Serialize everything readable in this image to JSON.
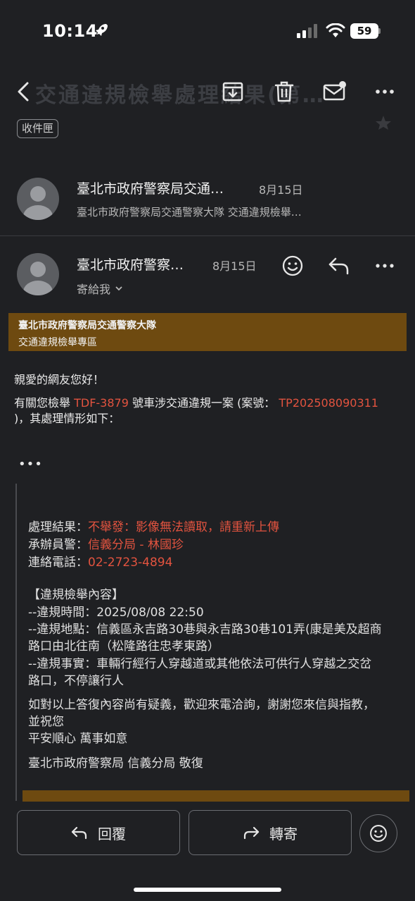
{
  "status": {
    "time": "10:14",
    "battery": "59"
  },
  "toolbar": {
    "ghost_title": "交通違規檢舉處理結果(第…",
    "inbox_label": "收件匣"
  },
  "thread": {
    "first": {
      "sender": "臺北市政府警察局交通…",
      "date": "8月15日",
      "preview": "臺北市政府警察局交通警察大隊 交通違規檢舉…"
    },
    "second": {
      "sender": "臺北市政府警察…",
      "date": "8月15日",
      "to_me": "寄給我"
    }
  },
  "banner": {
    "line1": "臺北市政府警察局交通警察大隊",
    "line2": "交通違規檢舉專區"
  },
  "message": {
    "greeting": "親愛的網友您好！",
    "line_a": "有關您檢舉 ",
    "plate": "TDF-3879",
    "line_b": " 號車涉交通違規一案 (案號： ",
    "case_no": "TP202508090311",
    "line_c": ")，其處理情形如下：",
    "ellipsis": "•••"
  },
  "quoted": {
    "result_label": "處理結果：",
    "result_value": "不舉發：影像無法讀取，請重新上傳",
    "officer_label": "承辦員警：",
    "officer_value": "信義分局 - 林國珍",
    "phone_label": "連絡電話：",
    "phone_value": "02-2723-4894",
    "section_title": "【違規檢舉內容】",
    "time_line": "--違規時間：2025/08/08 22:50",
    "place_line1": "--違規地點：信義區永吉路30巷與永吉路30巷101弄(康是美及超商",
    "place_line2": "路口由北往南（松隆路往忠孝東路）",
    "fact_line1": "--違規事實：車輛行經行人穿越道或其他依法可供行人穿越之交岔",
    "fact_line2": "路口，不停讓行人",
    "closing_line1": "如對以上答復內容尚有疑義，歡迎來電洽詢，謝謝您來信與指教，",
    "closing_line2": "並祝您",
    "closing_line3": "平安順心 萬事如意",
    "signature": "臺北市政府警察局 信義分局 敬復"
  },
  "actions": {
    "reply": "回覆",
    "forward": "轉寄"
  }
}
